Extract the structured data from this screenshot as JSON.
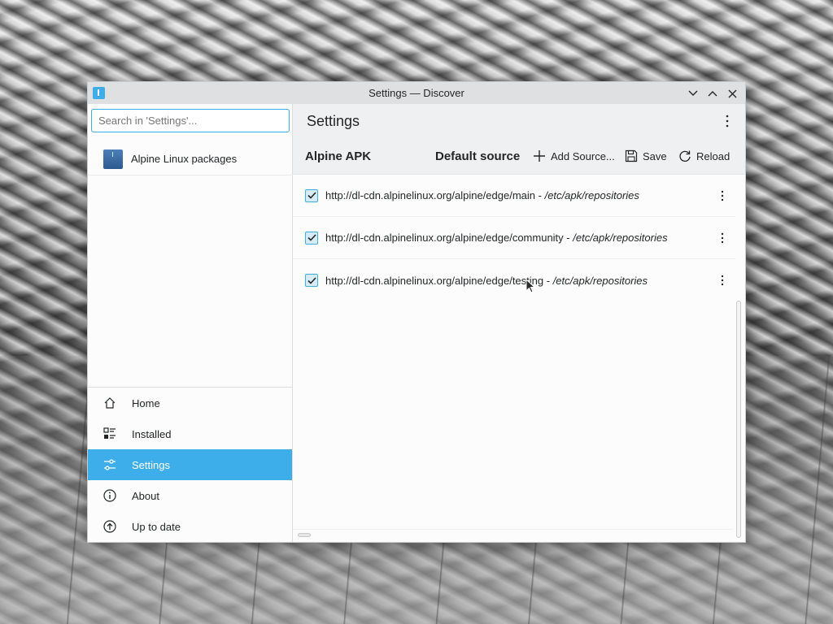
{
  "window": {
    "title": "Settings — Discover"
  },
  "sidebar": {
    "search_placeholder": "Search in 'Settings'...",
    "sources": [
      {
        "label": "Alpine Linux packages",
        "icon": "package-icon"
      }
    ],
    "nav": [
      {
        "label": "Home",
        "icon": "home-icon",
        "active": false
      },
      {
        "label": "Installed",
        "icon": "installed-icon",
        "active": false
      },
      {
        "label": "Settings",
        "icon": "settings-sliders-icon",
        "active": true
      },
      {
        "label": "About",
        "icon": "info-icon",
        "active": false
      },
      {
        "label": "Up to date",
        "icon": "up-arrow-icon",
        "active": false
      }
    ]
  },
  "main": {
    "title": "Settings",
    "backend": "Alpine APK",
    "default_source": "Default source",
    "toolbar": {
      "add_source": "Add Source...",
      "save": "Save",
      "reload": "Reload"
    },
    "repos": [
      {
        "url": "http://dl-cdn.alpinelinux.org/alpine/edge/main",
        "sep": " - ",
        "path": "/etc/apk/repositories",
        "checked": true
      },
      {
        "url": "http://dl-cdn.alpinelinux.org/alpine/edge/community",
        "sep": " - ",
        "path": "/etc/apk/repositories",
        "checked": true
      },
      {
        "url": "http://dl-cdn.alpinelinux.org/alpine/edge/testing",
        "sep": " - ",
        "path": "/etc/apk/repositories",
        "checked": true
      }
    ]
  },
  "colors": {
    "accent": "#3daee9",
    "text": "#232627",
    "header_bg": "#eff0f1",
    "titlebar_bg": "#dee0e2"
  }
}
